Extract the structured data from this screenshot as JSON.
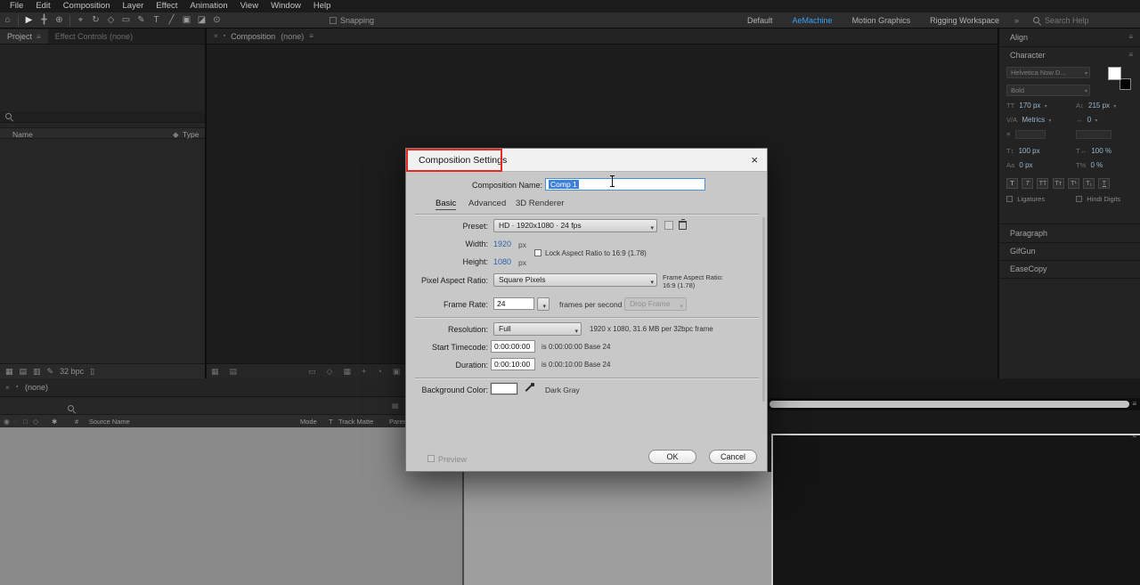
{
  "colors": {
    "accent": "#3aa0f6",
    "annotation": "#e8291f",
    "dialog_value": "#2e62a8",
    "selection": "#3f80d6",
    "character_value": "#9ab6cc"
  },
  "menubar": {
    "items": [
      "File",
      "Edit",
      "Composition",
      "Layer",
      "Effect",
      "Animation",
      "View",
      "Window",
      "Help"
    ]
  },
  "toolbar": {
    "snapping_label": "Snapping",
    "workspaces": [
      {
        "label": "Default"
      },
      {
        "label": "AeMachine"
      },
      {
        "label": "Motion Graphics"
      },
      {
        "label": "Rigging Workspace"
      }
    ],
    "overflow": "»",
    "search_placeholder": "Search Help"
  },
  "project_panel": {
    "tab_project": "Project",
    "tab_effect_controls": "Effect Controls (none)",
    "name_column": "Name",
    "type_column": "Type",
    "footer_bpc": "32 bpc"
  },
  "viewer": {
    "tab_label": "Composition",
    "tab_none": "(none)"
  },
  "timeline_panel": {
    "tab_none": "(none)",
    "col_source_name": "Source Name",
    "col_mode": "Mode",
    "col_t": "T",
    "col_track_matte": "Track Matte",
    "col_parent": "Parent & Link"
  },
  "right_panel": {
    "align_title": "Align",
    "character_title": "Character",
    "font_family": "Helvetica Now D...",
    "font_style": "Bold",
    "font_size_value": "170 px",
    "leading_value": "215 px",
    "kerning_value": "Metrics",
    "tracking_value": "0",
    "vscale_value": "100 px",
    "hscale_value": "100 %",
    "baseline_value": "0 px",
    "tsume_value": "0 %",
    "ligatures_label": "Ligatures",
    "hindi_label": "Hindi Digits",
    "paragraph_title": "Paragraph",
    "gifgun_title": "GifGun",
    "easecopy_title": "EaseCopy"
  },
  "dialog": {
    "title": "Composition Settings",
    "close": "×",
    "name_label": "Composition Name:",
    "name_value": "Comp 1",
    "tab_basic": "Basic",
    "tab_advanced": "Advanced",
    "tab_renderer": "3D Renderer",
    "preset_label": "Preset:",
    "preset_value": "HD · 1920x1080 · 24 fps",
    "width_label": "Width:",
    "width_value": "1920",
    "width_unit": "px",
    "height_label": "Height:",
    "height_value": "1080",
    "height_unit": "px",
    "lock_aspect_label": "Lock Aspect Ratio to 16:9 (1.78)",
    "par_label": "Pixel Aspect Ratio:",
    "par_value": "Square Pixels",
    "frame_aspect_line1": "Frame Aspect Ratio:",
    "frame_aspect_line2": "16:9 (1.78)",
    "frame_rate_label": "Frame Rate:",
    "frame_rate_value": "24",
    "fps_label": "frames per second",
    "drop_frame_label": "Drop Frame",
    "resolution_label": "Resolution:",
    "resolution_value": "Full",
    "resolution_info": "1920 x 1080, 31.6 MB per 32bpc frame",
    "start_label": "Start Timecode:",
    "start_value": "0:00:00:00",
    "start_info": "is 0:00:00:00 Base 24",
    "duration_label": "Duration:",
    "duration_value": "0:00:10:00",
    "duration_info": "is 0:00:10:00 Base 24",
    "bg_label": "Background Color:",
    "bg_name": "Dark Gray",
    "preview_label": "Preview",
    "ok_label": "OK",
    "cancel_label": "Cancel"
  }
}
